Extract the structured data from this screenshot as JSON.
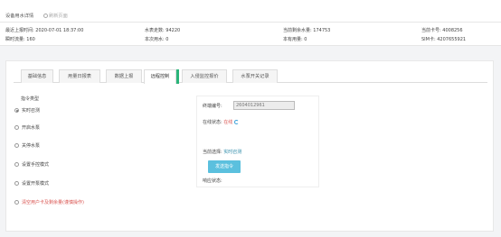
{
  "header": {
    "title": "设备用水详情",
    "refresh_label": "刷新页面"
  },
  "info": {
    "last_report_label": "最近上报时间:",
    "last_report_value": "2020-07-01 18:37:00",
    "water_total_label": "水表走数:",
    "water_total_value": "94220",
    "remaining_water_label": "当前剩余水量:",
    "remaining_water_value": "174753",
    "card_no_label": "当前卡号:",
    "card_no_value": "4008256",
    "cumulative_flow_label": "瞬时流量:",
    "cumulative_flow_value": "160",
    "this_water_label": "本次用水:",
    "this_water_value": "0",
    "this_electric_label": "本有用量:",
    "this_electric_value": "0",
    "sim_label": "SIM卡:",
    "sim_value": "4207655921"
  },
  "tabs": [
    {
      "label": "基础信息"
    },
    {
      "label": "用量日报表"
    },
    {
      "label": "数据上报"
    },
    {
      "label": "远程控制"
    },
    {
      "label": "入侵监控报价"
    },
    {
      "label": "水泵开关记录"
    }
  ],
  "command": {
    "heading": "指令类型",
    "options": [
      {
        "label": "实时召测",
        "checked": true
      },
      {
        "label": "开启水泵",
        "checked": false
      },
      {
        "label": "关停水泵",
        "checked": false
      },
      {
        "label": "设置手控模式",
        "checked": false
      },
      {
        "label": "设置开泵模式",
        "checked": false
      },
      {
        "label": "清空用户卡及剩余量(谨慎操作)",
        "checked": false
      }
    ]
  },
  "detail": {
    "terminal_label": "终端编号:",
    "terminal_value": "2604012961",
    "online_label": "在线状态:",
    "online_value": "在线",
    "mode_label": "当前选择:",
    "mode_value": "实时召测",
    "send_label": "发送指令",
    "result_label": "响应状态:"
  },
  "colors": {
    "accent_green": "#2bb57a",
    "button_blue": "#5bc0de",
    "status_red": "#d9534f"
  }
}
